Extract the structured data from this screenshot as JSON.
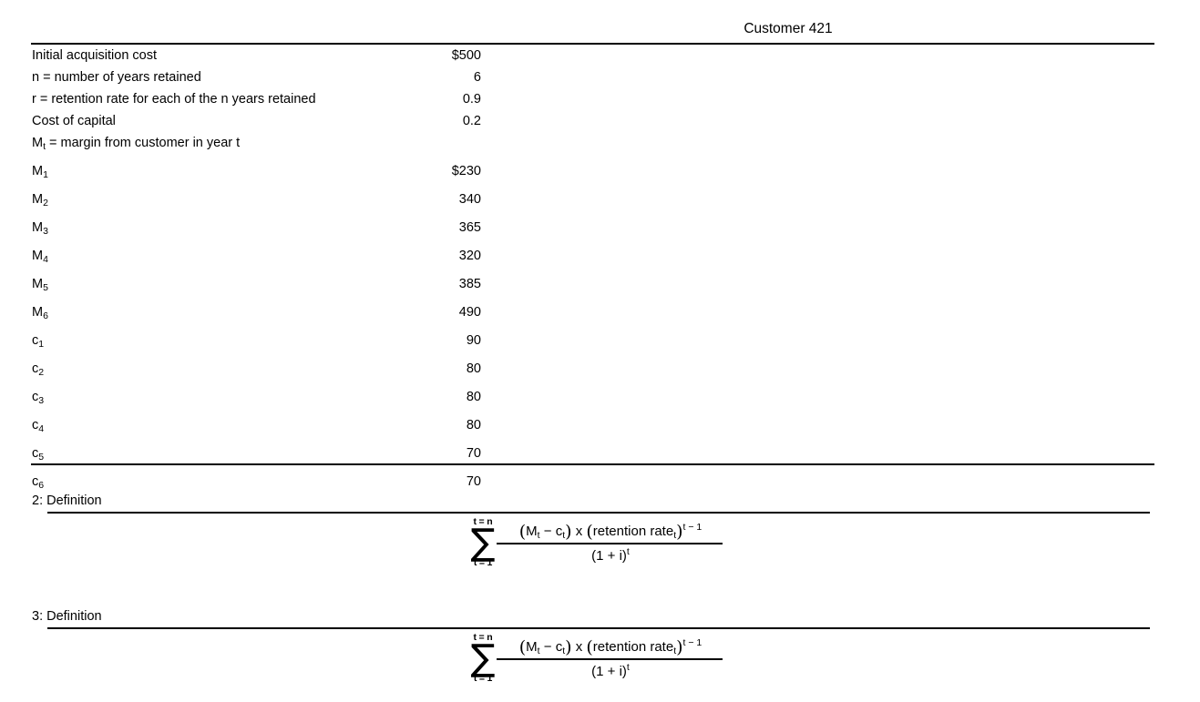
{
  "header": {
    "title": "Customer 421"
  },
  "table": {
    "rows": [
      {
        "label": "Initial acquisition cost",
        "value": "$500"
      },
      {
        "label": "n = number of years retained",
        "value": "6"
      },
      {
        "label": "r = retention rate for each of the n years retained",
        "value": "0.9"
      },
      {
        "label": "Cost of capital",
        "value": "0.2"
      },
      {
        "label_base": "M",
        "label_sub": "t",
        "label_rest": " = margin from customer in year t",
        "value": ""
      },
      {
        "label_base": "M",
        "label_sub": "1",
        "label_rest": "",
        "value": "$230"
      },
      {
        "label_base": "M",
        "label_sub": "2",
        "label_rest": "",
        "value": "340"
      },
      {
        "label_base": "M",
        "label_sub": "3",
        "label_rest": "",
        "value": "365"
      },
      {
        "label_base": "M",
        "label_sub": "4",
        "label_rest": "",
        "value": "320"
      },
      {
        "label_base": "M",
        "label_sub": "5",
        "label_rest": "",
        "value": "385"
      },
      {
        "label_base": "M",
        "label_sub": "6",
        "label_rest": "",
        "value": "490"
      },
      {
        "label_base": "c",
        "label_sub": "1",
        "label_rest": "",
        "value": "90"
      },
      {
        "label_base": "c",
        "label_sub": "2",
        "label_rest": "",
        "value": "80"
      },
      {
        "label_base": "c",
        "label_sub": "3",
        "label_rest": "",
        "value": "80"
      },
      {
        "label_base": "c",
        "label_sub": "4",
        "label_rest": "",
        "value": "80"
      },
      {
        "label_base": "c",
        "label_sub": "5",
        "label_rest": "",
        "value": "70"
      },
      {
        "label_base": "c",
        "label_sub": "6",
        "label_rest": "",
        "value": "70"
      }
    ]
  },
  "definitions": [
    {
      "label": "2: Definition",
      "formula": {
        "sigma_upper": "t = n",
        "sigma_glyph": "∑",
        "sigma_lower": "t = 1",
        "num_open_paren": "(",
        "num_m": "M",
        "num_m_sub": "t",
        "num_minus": " − ",
        "num_c": "c",
        "num_c_sub": "t",
        "num_close_paren": ")",
        "num_times": " x ",
        "num_open_paren2": "(",
        "num_retention": "retention rate",
        "num_retention_sub": "t",
        "num_close_paren2": ")",
        "num_exp": "t − 1",
        "den_text": "(1 + i)",
        "den_exp": "t"
      }
    },
    {
      "label": "3: Definition",
      "formula": {
        "sigma_upper": "t = n",
        "sigma_glyph": "∑",
        "sigma_lower": "t = 1",
        "num_open_paren": "(",
        "num_m": "M",
        "num_m_sub": "t",
        "num_minus": " − ",
        "num_c": "c",
        "num_c_sub": "t",
        "num_close_paren": ")",
        "num_times": " x ",
        "num_open_paren2": "(",
        "num_retention": "retention rate",
        "num_retention_sub": "t",
        "num_close_paren2": ")",
        "num_exp": "t − 1",
        "den_text": "(1 + i)",
        "den_exp": "t"
      }
    }
  ],
  "colors": {
    "text": "#000000",
    "rule": "#000000",
    "background": "#ffffff"
  }
}
